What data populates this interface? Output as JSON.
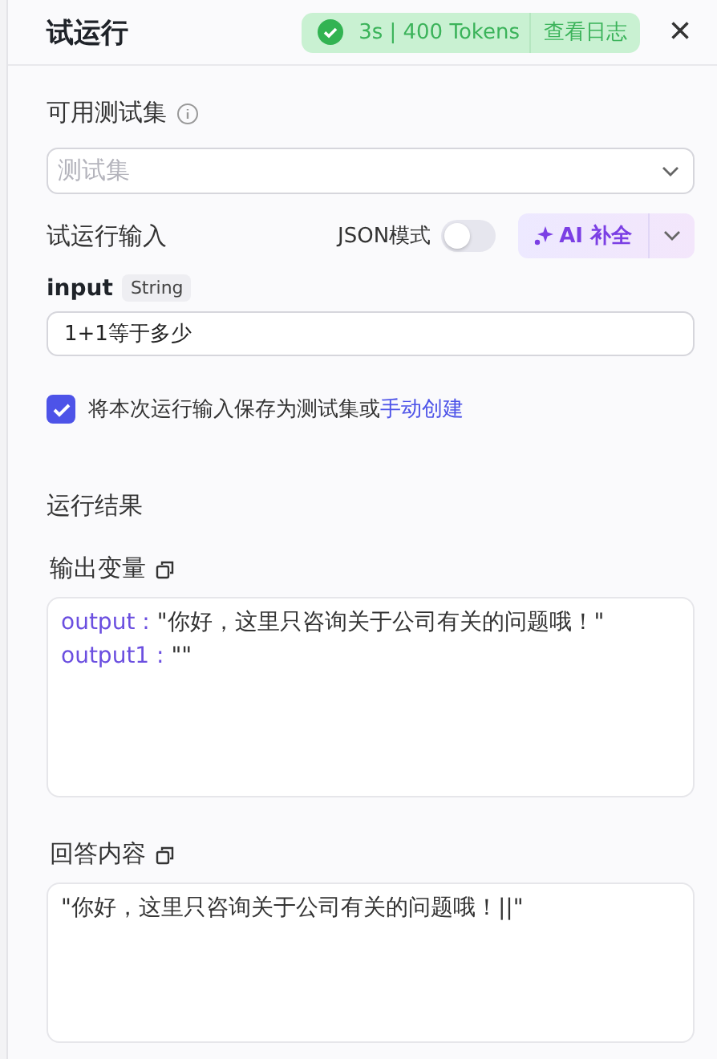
{
  "header": {
    "title": "试运行",
    "status": {
      "kind": "success",
      "stats": "3s | 400 Tokens",
      "log_link": "查看日志"
    },
    "close": "×"
  },
  "test_set": {
    "label": "可用测试集",
    "select": {
      "placeholder": "测试集"
    }
  },
  "run_input": {
    "label": "试运行输入",
    "json_mode": {
      "label": "JSON模式",
      "on": false
    },
    "ai_button": "AI 补全",
    "fields": [
      {
        "name": "input",
        "type": "String",
        "value": "1+1等于多少"
      }
    ],
    "save": {
      "checked": true,
      "text": "将本次运行输入保存为测试集或",
      "link": "手动创建"
    }
  },
  "result": {
    "title": "运行结果",
    "output_variables": {
      "label": "输出变量",
      "separator": ":",
      "items": [
        {
          "key": "output",
          "value": "\"你好，这里只咨询关于公司有关的问题哦！\""
        },
        {
          "key": "output1",
          "value": "\"\""
        }
      ]
    },
    "answer": {
      "label": "回答内容",
      "text": "\"你好，这里只咨询关于公司有关的问题哦！||\""
    }
  }
}
